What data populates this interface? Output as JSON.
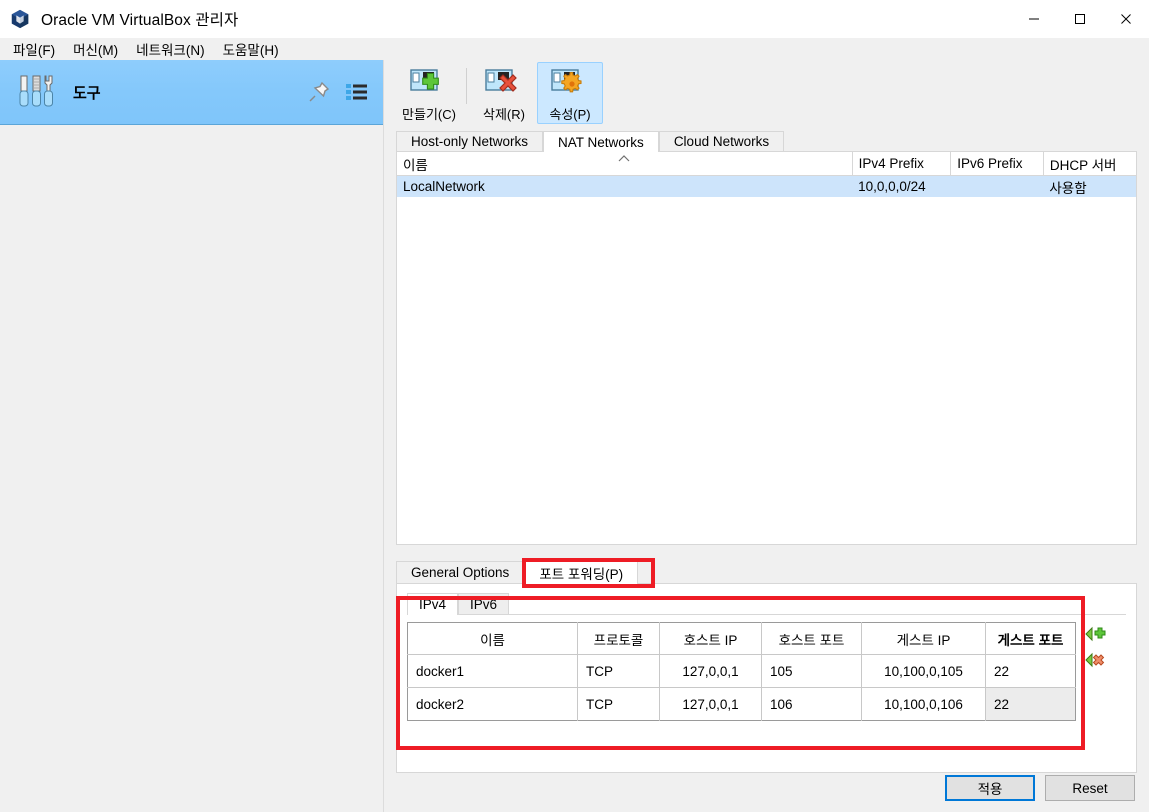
{
  "window": {
    "title": "Oracle VM VirtualBox 관리자",
    "icon": "virtualbox-cube-icon",
    "controls": {
      "minimize": "minimize-icon",
      "maximize": "maximize-icon",
      "close": "close-icon"
    }
  },
  "menubar": {
    "items": [
      {
        "label": "파일(F)"
      },
      {
        "label": "머신(M)"
      },
      {
        "label": "네트워크(N)"
      },
      {
        "label": "도움말(H)"
      }
    ]
  },
  "sidebar": {
    "tools": {
      "label": "도구",
      "icon": "tools-icon",
      "pin_icon": "pin-icon",
      "list_icon": "list-icon"
    }
  },
  "toolbar": {
    "buttons": [
      {
        "label": "만들기(C)",
        "icon": "network-add-icon",
        "active": false
      },
      {
        "label": "삭제(R)",
        "icon": "network-remove-icon",
        "active": false
      },
      {
        "label": "속성(P)",
        "icon": "network-properties-icon",
        "active": true
      }
    ]
  },
  "network_tabs": [
    {
      "label": "Host-only Networks",
      "active": false
    },
    {
      "label": "NAT Networks",
      "active": true
    },
    {
      "label": "Cloud Networks",
      "active": false
    }
  ],
  "network_table": {
    "columns": [
      "이름",
      "IPv4 Prefix",
      "IPv6 Prefix",
      "DHCP 서버"
    ],
    "sort_column": "이름",
    "sort_direction": "ascending",
    "rows": [
      {
        "name": "LocalNetwork",
        "ipv4_prefix": "10,0,0,0/24",
        "ipv6_prefix": "",
        "dhcp_server": "사용함",
        "selected": true
      }
    ]
  },
  "detail_tabs": [
    {
      "label": "General Options",
      "active": false
    },
    {
      "label": "포트 포워딩(P)",
      "active": true,
      "highlighted": true
    }
  ],
  "ip_tabs": [
    {
      "label": "IPv4",
      "active": true
    },
    {
      "label": "IPv6",
      "active": false
    }
  ],
  "port_forwarding": {
    "columns": [
      "이름",
      "프로토콜",
      "호스트 IP",
      "호스트 포트",
      "게스트 IP",
      "게스트 포트"
    ],
    "bold_column": "게스트 포트",
    "rows": [
      {
        "name": "docker1",
        "protocol": "TCP",
        "host_ip": "127,0,0,1",
        "host_port": "105",
        "guest_ip": "10,100,0,105",
        "guest_port": "22",
        "guest_port_selected": false
      },
      {
        "name": "docker2",
        "protocol": "TCP",
        "host_ip": "127,0,0,1",
        "host_port": "106",
        "guest_ip": "10,100,0,106",
        "guest_port": "22",
        "guest_port_selected": true
      }
    ],
    "add_rule_icon": "add-rule-icon",
    "remove_rule_icon": "remove-rule-icon"
  },
  "actions": {
    "apply_label": "적용",
    "reset_label": "Reset"
  },
  "colors": {
    "accent_blue": "#0078d7",
    "selection_blue": "#cde4fb",
    "sidebar_blue": "#85c9fb",
    "annotation_red": "#ee1c25",
    "toolbar_active": "#cce8ff"
  }
}
